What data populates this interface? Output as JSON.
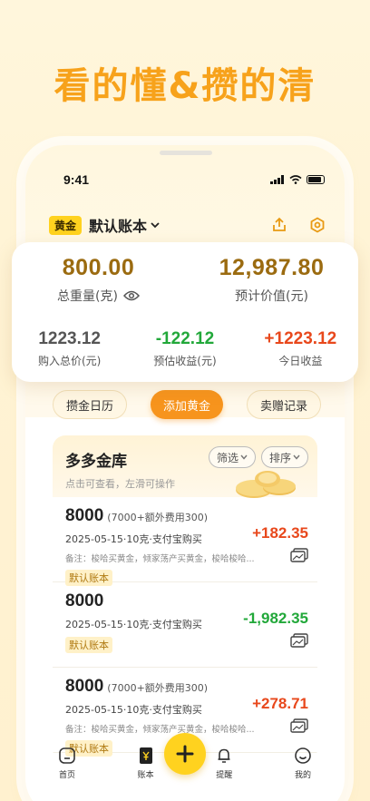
{
  "hero": {
    "title": "看的懂&攒的清"
  },
  "status_bar": {
    "time": "9:41"
  },
  "header": {
    "tag": "黄金",
    "book_name": "默认账本"
  },
  "summary": {
    "total_weight": {
      "value": "800.00",
      "label": "总重量(克)"
    },
    "estimated_value": {
      "value": "12,987.80",
      "label": "预计价值(元)"
    },
    "purchase_total": {
      "value": "1223.12",
      "label": "购入总价(元)"
    },
    "estimated_profit": {
      "value": "-122.12",
      "label": "预估收益(元)"
    },
    "today_profit": {
      "value": "+1223.12",
      "label": "今日收益"
    }
  },
  "actions": {
    "calendar": "攒金日历",
    "add_gold": "添加黄金",
    "sell_gift": "卖赠记录"
  },
  "vault": {
    "title": "多多金库",
    "subtitle": "点击可查看，左滑可操作",
    "filter": "筛选",
    "sort": "排序",
    "items": [
      {
        "amount": "8000",
        "extra": "(7000+额外费用300)",
        "meta": "2025-05-15·10克·支付宝购买",
        "note": "备注：梭哈买黄金，倾家荡产买黄金，梭哈梭哈...",
        "tag": "默认账本",
        "value": "+182.35"
      },
      {
        "amount": "8000",
        "extra": "",
        "meta": "2025-05-15·10克·支付宝购买",
        "note": "",
        "tag": "默认账本",
        "value": "-1,982.35"
      },
      {
        "amount": "8000",
        "extra": "(7000+额外费用300)",
        "meta": "2025-05-15·10克·支付宝购买",
        "note": "备注：梭哈买黄金，倾家荡产买黄金，梭哈梭哈...",
        "tag": "默认账本",
        "value": "+278.71"
      }
    ]
  },
  "tabbar": {
    "home": "首页",
    "ledger": "账本",
    "remind": "提醒",
    "mine": "我的"
  },
  "colors": {
    "accent": "#f7941d",
    "gold": "#ffd21f",
    "positive": "#e8481c",
    "negative": "#22a83a"
  }
}
